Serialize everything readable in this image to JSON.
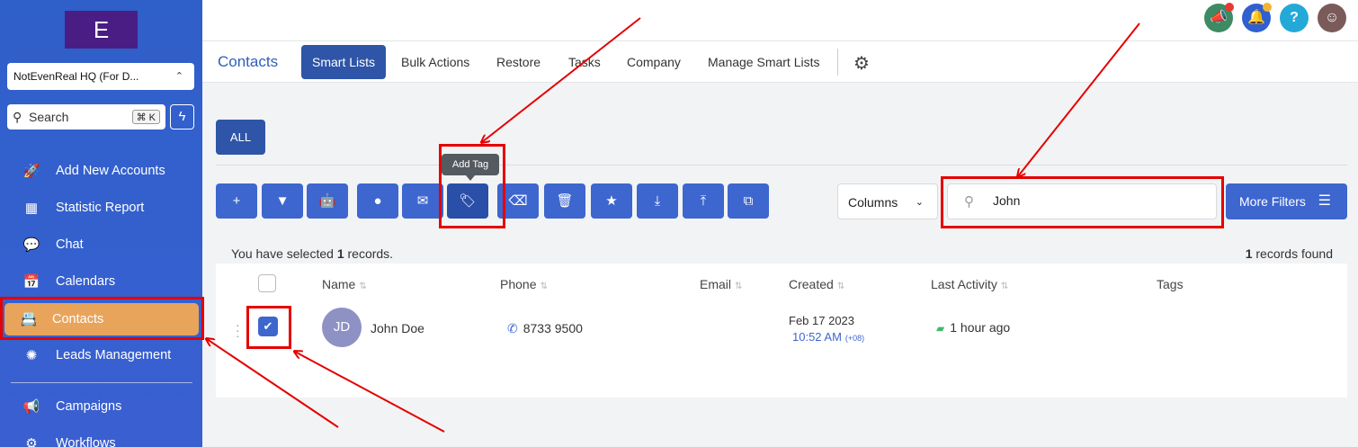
{
  "sidebar": {
    "logo": "E",
    "account": "NotEvenReal HQ (For D...",
    "search_placeholder": "Search",
    "search_shortcut": "⌘ K",
    "items": [
      {
        "label": "Add New Accounts",
        "icon": "rocket-icon"
      },
      {
        "label": "Statistic Report",
        "icon": "dashboard-grid-icon"
      },
      {
        "label": "Chat",
        "icon": "chat-icon"
      },
      {
        "label": "Calendars",
        "icon": "calendar-icon"
      },
      {
        "label": "Contacts",
        "icon": "contacts-icon",
        "active": true
      },
      {
        "label": "Leads Management",
        "icon": "leads-icon"
      },
      {
        "label": "Campaigns",
        "icon": "megaphone-icon"
      },
      {
        "label": "Workflows",
        "icon": "workflow-icon"
      }
    ]
  },
  "tabs": [
    "Contacts",
    "Smart Lists",
    "Bulk Actions",
    "Restore",
    "Tasks",
    "Company",
    "Manage Smart Lists"
  ],
  "all_label": "ALL",
  "toolbar": {
    "tooltip": "Add Tag",
    "columns_label": "Columns",
    "search_value": "John",
    "more_filters_label": "More Filters"
  },
  "summary": {
    "selected_prefix": "You have selected",
    "selected_count": "1",
    "selected_suffix": "records.",
    "found_count": "1",
    "found_suffix": "records found"
  },
  "table": {
    "headers": [
      "Name",
      "Phone",
      "Email",
      "Created",
      "Last Activity",
      "Tags"
    ],
    "row": {
      "initials": "JD",
      "name": "John Doe",
      "phone": "8733 9500",
      "created_date": "Feb 17 2023",
      "created_time": "10:52 AM",
      "created_tz": "(+08)",
      "last_activity": "1 hour ago"
    }
  },
  "colors": {
    "sidebar": "#3560cf",
    "accent": "#3d66cf",
    "active_nav": "#e9a45b",
    "annotation": "#e50000"
  }
}
